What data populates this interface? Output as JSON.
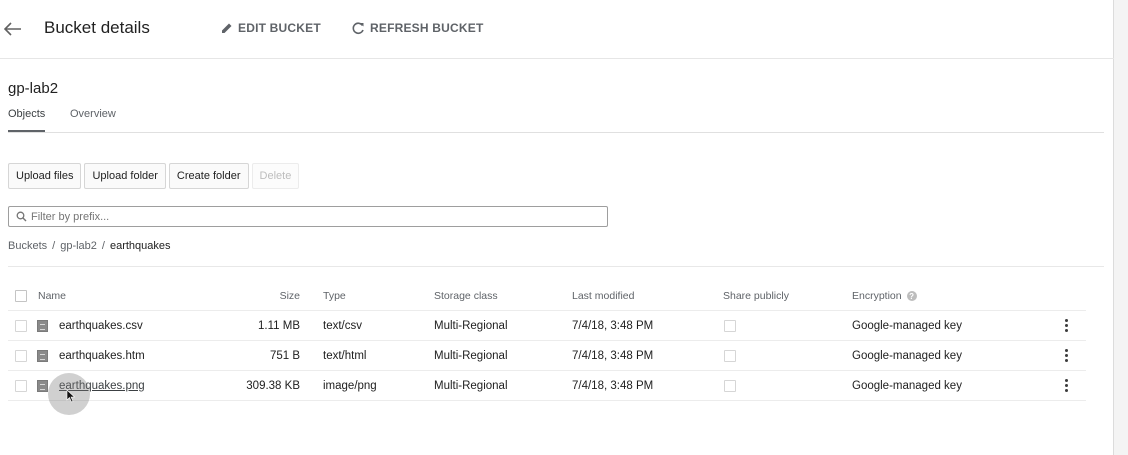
{
  "header": {
    "title": "Bucket details",
    "actions": {
      "edit": "EDIT BUCKET",
      "refresh": "REFRESH BUCKET"
    }
  },
  "bucket": {
    "name": "gp-lab2"
  },
  "tabs": [
    {
      "label": "Objects",
      "active": true
    },
    {
      "label": "Overview",
      "active": false
    }
  ],
  "toolbar": {
    "upload_files": "Upload files",
    "upload_folder": "Upload folder",
    "create_folder": "Create folder",
    "delete": "Delete"
  },
  "filter": {
    "placeholder": "Filter by prefix..."
  },
  "breadcrumb": {
    "root": "Buckets",
    "bucket": "gp-lab2",
    "folder": "earthquakes",
    "separator": "/"
  },
  "table": {
    "columns": {
      "name": "Name",
      "size": "Size",
      "type": "Type",
      "storage": "Storage class",
      "modified": "Last modified",
      "share": "Share publicly",
      "encryption": "Encryption"
    },
    "rows": [
      {
        "name": "earthquakes.csv",
        "size": "1.11 MB",
        "type": "text/csv",
        "storage": "Multi-Regional",
        "modified": "7/4/18, 3:48 PM",
        "encryption": "Google-managed key"
      },
      {
        "name": "earthquakes.htm",
        "size": "751 B",
        "type": "text/html",
        "storage": "Multi-Regional",
        "modified": "7/4/18, 3:48 PM",
        "encryption": "Google-managed key"
      },
      {
        "name": "earthquakes.png",
        "size": "309.38 KB",
        "type": "image/png",
        "storage": "Multi-Regional",
        "modified": "7/4/18, 3:48 PM",
        "encryption": "Google-managed key"
      }
    ]
  },
  "icons": {
    "back": "arrow-back-icon",
    "edit": "pencil-icon",
    "refresh": "refresh-icon",
    "search": "search-icon",
    "info": "info-icon",
    "file": "file-icon",
    "more": "more-vert-icon"
  },
  "colors": {
    "text": "#212121",
    "secondary": "#5f6368",
    "border": "#e0e0e0"
  }
}
